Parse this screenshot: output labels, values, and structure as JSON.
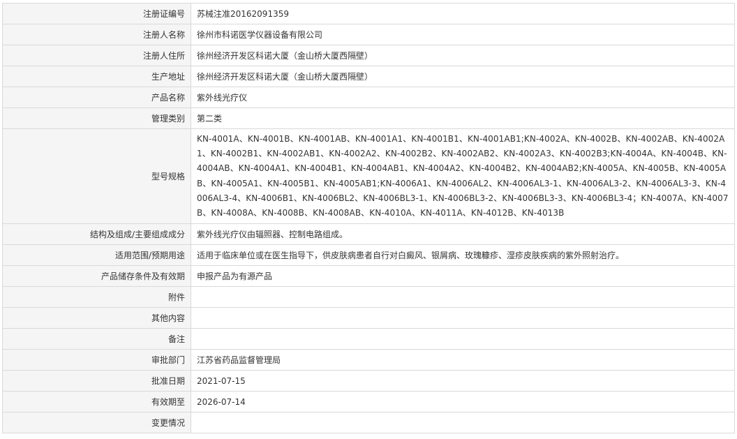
{
  "rows": [
    {
      "label": "注册证编号",
      "value": "苏械注准20162091359"
    },
    {
      "label": "注册人名称",
      "value": "徐州市科诺医学仪器设备有限公司"
    },
    {
      "label": "注册人住所",
      "value": "徐州经济开发区科诺大厦（金山桥大厦西隔壁）"
    },
    {
      "label": "生产地址",
      "value": "徐州经济开发区科诺大厦（金山桥大厦西隔壁）"
    },
    {
      "label": "产品名称",
      "value": "紫外线光疗仪"
    },
    {
      "label": "管理类别",
      "value": "第二类"
    },
    {
      "label": "型号规格",
      "value": "KN-4001A、KN-4001B、KN-4001AB、KN-4001A1、KN-4001B1、KN-4001AB1;KN-4002A、KN-4002B、KN-4002AB、KN-4002A1、KN-4002B1、KN-4002AB1、KN-4002A2、KN-4002B2、KN-4002AB2、KN-4002A3、KN-4002B3;KN-4004A、KN-4004B、KN-4004AB、KN-4004A1、KN-4004B1、KN-4004AB1、KN-4004A2、KN-4004B2、KN-4004AB2;KN-4005A、KN-4005B、KN-4005AB、KN-4005A1、KN-4005B1、KN-4005AB1;KN-4006A1、KN-4006AL2、KN-4006AL3-1、KN-4006AL3-2、KN-4006AL3-3、KN-4006AL3-4、KN-4006B1、KN-4006BL2、KN-4006BL3-1、KN-4006BL3-2、KN-4006BL3-3、KN-4006BL3-4；KN-4007A、KN-4007B、KN-4008A、KN-4008B、KN-4008AB、KN-4010A、KN-4011A、KN-4012B、KN-4013B"
    },
    {
      "label": "结构及组成/主要组成成分",
      "value": "紫外线光疗仪由辐照器、控制电路组成。"
    },
    {
      "label": "适用范围/预期用途",
      "value": "适用于临床单位或在医生指导下，供皮肤病患者自行对白癜风、银屑病、玫瑰糠疹、湿疹皮肤疾病的紫外照射治疗。"
    },
    {
      "label": "产品储存条件及有效期",
      "value": "申报产品为有源产品"
    },
    {
      "label": "附件",
      "value": ""
    },
    {
      "label": "其他内容",
      "value": ""
    },
    {
      "label": "备注",
      "value": ""
    },
    {
      "label": "审批部门",
      "value": "江苏省药品监督管理局"
    },
    {
      "label": "批准日期",
      "value": "2021-07-15"
    },
    {
      "label": "有效期至",
      "value": "2026-07-14"
    },
    {
      "label": "变更情况",
      "value": ""
    }
  ]
}
